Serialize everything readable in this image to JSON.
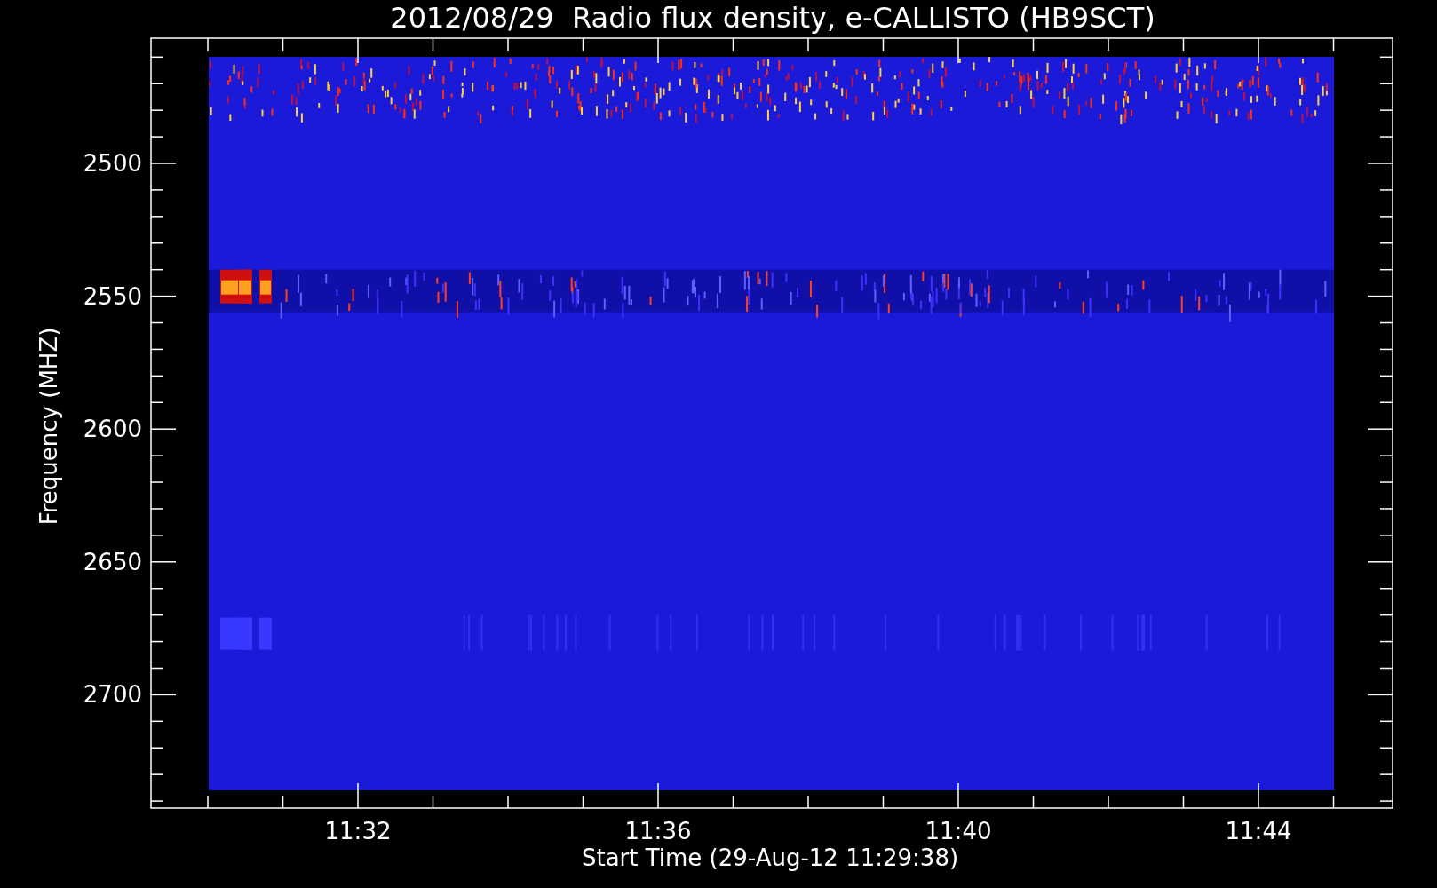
{
  "title": "2012/08/29  Radio flux density, e-CALLISTO (HB9SCT)",
  "y_axis": {
    "label": "Frequency (MHZ)",
    "ticks": [
      "2500",
      "2550",
      "2600",
      "2650",
      "2700"
    ]
  },
  "x_axis": {
    "label": "Start Time (29-Aug-12 11:29:38)",
    "ticks": [
      "11:32",
      "11:36",
      "11:40",
      "11:44"
    ]
  }
}
